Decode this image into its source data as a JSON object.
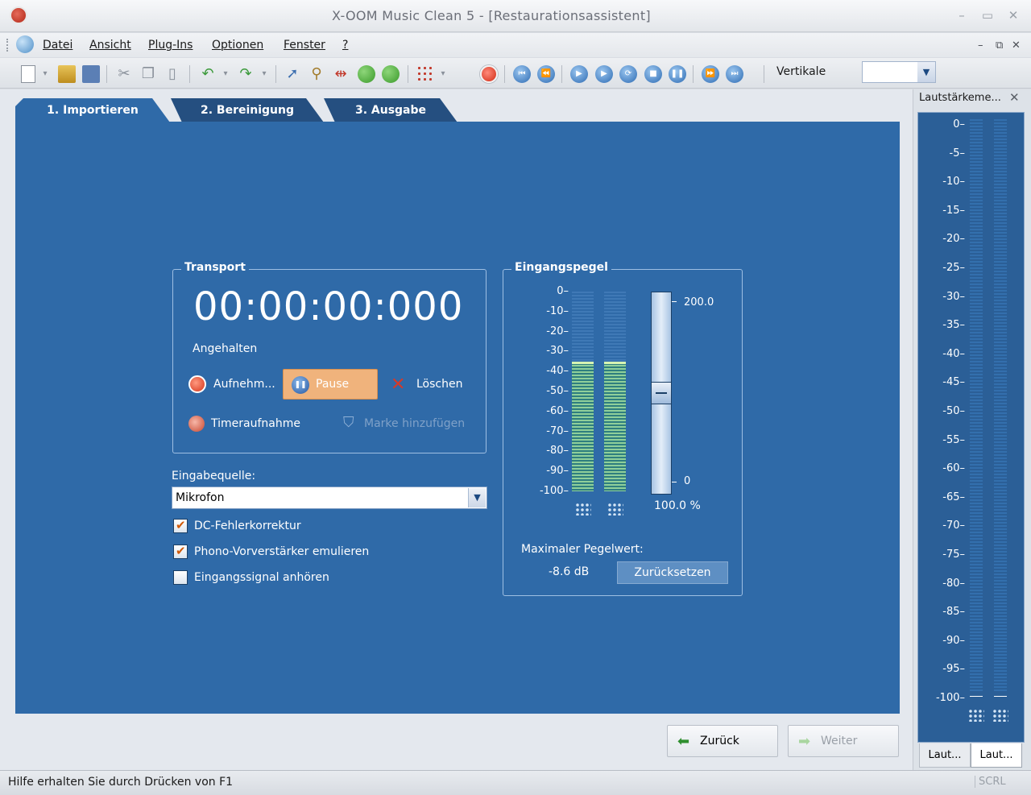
{
  "window": {
    "title": "X-OOM Music Clean 5 - [Restaurationsassistent]"
  },
  "menu": {
    "items": [
      "Datei",
      "Ansicht",
      "Plug-Ins",
      "Optionen",
      "Fenster",
      "?"
    ]
  },
  "toolbar": {
    "view_label": "Vertikale",
    "view_select_value": ""
  },
  "tabs": [
    {
      "label": "1. Importieren",
      "active": true
    },
    {
      "label": "2. Bereinigung",
      "active": false
    },
    {
      "label": "3. Ausgabe",
      "active": false
    }
  ],
  "transport": {
    "title": "Transport",
    "timecode": "00:00:00:000",
    "status": "Angehalten",
    "record_label": "Aufnehm...",
    "pause_label": "Pause",
    "delete_label": "Löschen",
    "timer_label": "Timeraufnahme",
    "marker_label": "Marke hinzufügen"
  },
  "input": {
    "source_label": "Eingabequelle:",
    "source_value": "Mikrofon",
    "options": [
      {
        "label": "DC-Fehlerkorrektur",
        "checked": true
      },
      {
        "label": "Phono-Vorverstärker emulieren",
        "checked": true
      },
      {
        "label": "Eingangssignal anhören",
        "checked": false
      }
    ]
  },
  "level": {
    "title": "Eingangspegel",
    "scale": [
      "0",
      "-10",
      "-20",
      "-30",
      "-40",
      "-50",
      "-60",
      "-70",
      "-80",
      "-90",
      "-100"
    ],
    "left_level_db": -35,
    "right_level_db": -35,
    "gain_max": "200.0",
    "gain_min": "0",
    "gain_value": "100.0 %",
    "gain_fraction": 0.5,
    "max_label": "Maximaler Pegelwert:",
    "max_value": "-8.6 dB",
    "reset_label": "Zurücksetzen"
  },
  "navigation": {
    "back_label": "Zurück",
    "next_label": "Weiter"
  },
  "sidebar": {
    "title": "Lautstärkeme...",
    "scale": [
      "0",
      "-5",
      "-10",
      "-15",
      "-20",
      "-25",
      "-30",
      "-35",
      "-40",
      "-45",
      "-50",
      "-55",
      "-60",
      "-65",
      "-70",
      "-75",
      "-80",
      "-85",
      "-90",
      "-95",
      "-100"
    ],
    "tabs": [
      "Laut...",
      "Laut..."
    ]
  },
  "statusbar": {
    "help": "Hilfe erhalten Sie durch Drücken von F1",
    "indicator": "SCRL"
  },
  "colors": {
    "panel": "#2f6aa8",
    "pause_button": "#f0b37c",
    "meter_fill": "#8fcf9a"
  }
}
